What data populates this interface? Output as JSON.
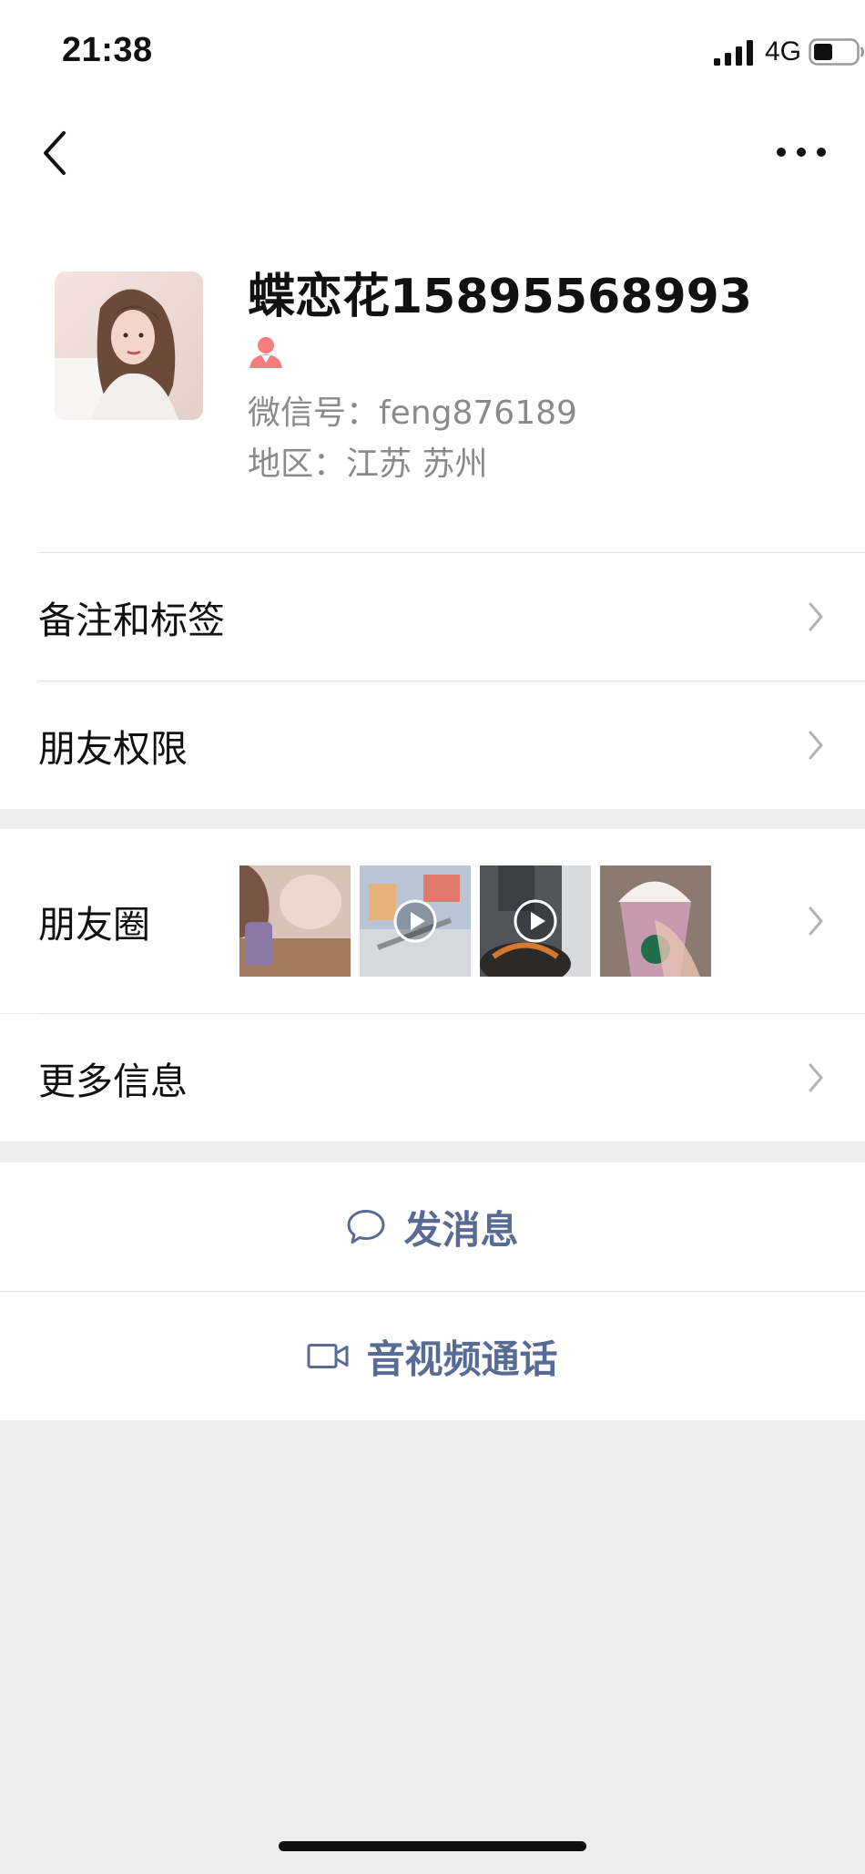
{
  "status_bar": {
    "time": "21:38",
    "network": "4G",
    "signal_icon": "signal-bars-icon",
    "battery_icon": "battery-icon",
    "battery_level": 0.4
  },
  "nav": {
    "back_icon": "chevron-left-icon",
    "more_icon": "more-dots-icon"
  },
  "profile": {
    "name": "蝶恋花15895568993",
    "gender_icon": "female-icon",
    "gender_color": "#f37e7d",
    "wechat_id": "微信号：feng876189",
    "region": "地区：江苏 苏州"
  },
  "menu": {
    "remarks_tags": "备注和标签",
    "friend_permissions": "朋友权限",
    "moments": "朋友圈",
    "more_info": "更多信息"
  },
  "moments_thumbs": [
    {
      "kind": "photo"
    },
    {
      "kind": "video"
    },
    {
      "kind": "video"
    },
    {
      "kind": "photo"
    }
  ],
  "actions": {
    "send_message": "发消息",
    "send_message_icon": "chat-bubble-icon",
    "video_call": "音视频通话",
    "video_call_icon": "video-camera-icon"
  },
  "colors": {
    "link": "#576b95",
    "background": "#ededed",
    "secondary_text": "#8a8a8a"
  }
}
